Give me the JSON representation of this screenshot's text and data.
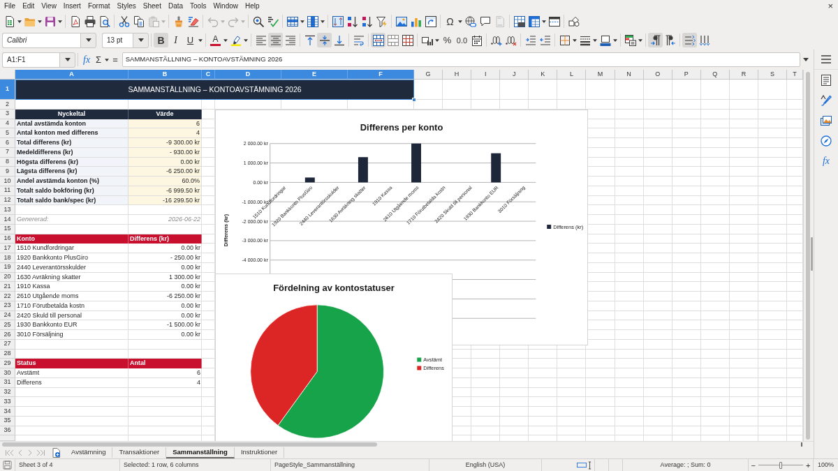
{
  "menu_bar": {
    "items": [
      "File",
      "Edit",
      "View",
      "Insert",
      "Format",
      "Styles",
      "Sheet",
      "Data",
      "Tools",
      "Window",
      "Help"
    ],
    "close": "×"
  },
  "standard_toolbar": {
    "special_character": "Ω",
    "disabled": {
      "paste": true,
      "undo": true,
      "redo": true,
      "headers_footers": true
    }
  },
  "formatting_toolbar": {
    "font_name": "Calibri",
    "font_size": "13 pt",
    "bold": "B",
    "italic": "I",
    "underline": "U",
    "font_color": "A",
    "percent": "%",
    "number": "0.0",
    "pressed": {
      "bold": true,
      "italic": false,
      "underline": false,
      "align_left": false,
      "align_center": true,
      "align_right": false,
      "align_top": false,
      "align_middle": true,
      "align_bottom": false,
      "wrap_text": false,
      "merge_and_center": true,
      "left_to_right": true,
      "right_to_left": false,
      "text_left_to_right": true,
      "text_top_to_bottom": false
    }
  },
  "formula_bar": {
    "name_box": "A1:F1",
    "function_wizard": "fx",
    "sum": "Σ",
    "equals": "=",
    "content": "SAMMANSTÄLLNING – KONTOAVSTÄMNING 2026"
  },
  "sheet": {
    "columns": [
      {
        "label": "A",
        "selected": true
      },
      {
        "label": "B",
        "selected": true
      },
      {
        "label": "C",
        "selected": true
      },
      {
        "label": "D",
        "selected": true
      },
      {
        "label": "E",
        "selected": true
      },
      {
        "label": "F",
        "selected": true
      },
      {
        "label": "G",
        "selected": false
      },
      {
        "label": "H",
        "selected": false
      },
      {
        "label": "I",
        "selected": false
      },
      {
        "label": "J",
        "selected": false
      },
      {
        "label": "K",
        "selected": false
      },
      {
        "label": "L",
        "selected": false
      },
      {
        "label": "M",
        "selected": false
      },
      {
        "label": "N",
        "selected": false
      },
      {
        "label": "O",
        "selected": false
      },
      {
        "label": "P",
        "selected": false
      },
      {
        "label": "Q",
        "selected": false
      },
      {
        "label": "R",
        "selected": false
      },
      {
        "label": "S",
        "selected": false
      },
      {
        "label": "T",
        "selected": false
      }
    ],
    "rows": [
      {
        "number": "1",
        "selected": true,
        "kind": "title",
        "cells": [
          "SAMMANSTÄLLNING – KONTOAVSTÄMNING 2026"
        ]
      },
      {
        "number": "2",
        "selected": false,
        "kind": "blank"
      },
      {
        "number": "3",
        "selected": false,
        "kind": "key_header",
        "cells": [
          "Nyckeltal",
          "Värde"
        ]
      },
      {
        "number": "4",
        "selected": false,
        "kind": "key_figure",
        "cells": [
          "Antal avstämda konton",
          "6"
        ]
      },
      {
        "number": "5",
        "selected": false,
        "kind": "key_figure",
        "cells": [
          "Antal konton med differens",
          "4"
        ]
      },
      {
        "number": "6",
        "selected": false,
        "kind": "key_figure",
        "cells": [
          "Total differens (kr)",
          "-9 300.00 kr"
        ]
      },
      {
        "number": "7",
        "selected": false,
        "kind": "key_figure",
        "cells": [
          "Medeldifferens (kr)",
          "- 930.00 kr"
        ]
      },
      {
        "number": "8",
        "selected": false,
        "kind": "key_figure",
        "cells": [
          "Högsta differens (kr)",
          "0.00 kr"
        ]
      },
      {
        "number": "9",
        "selected": false,
        "kind": "key_figure",
        "cells": [
          "Lägsta differens (kr)",
          "-6 250.00 kr"
        ]
      },
      {
        "number": "10",
        "selected": false,
        "kind": "key_figure",
        "cells": [
          "Andel avstämda konton (%)",
          "60.0%"
        ]
      },
      {
        "number": "11",
        "selected": false,
        "kind": "key_figure",
        "cells": [
          "Totalt saldo bokföring (kr)",
          "-6 999.50 kr"
        ]
      },
      {
        "number": "12",
        "selected": false,
        "kind": "key_figure",
        "cells": [
          "Totalt saldo bank/spec (kr)",
          "-16 299.50 kr"
        ]
      },
      {
        "number": "13",
        "selected": false,
        "kind": "blank"
      },
      {
        "number": "14",
        "selected": false,
        "kind": "note",
        "cells": [
          "Genererad:",
          "2026-06-22"
        ]
      },
      {
        "number": "15",
        "selected": false,
        "kind": "blank"
      },
      {
        "number": "16",
        "selected": false,
        "kind": "table_header",
        "cells": [
          "Konto",
          "Differens (kr)"
        ]
      },
      {
        "number": "17",
        "selected": false,
        "kind": "entry",
        "cells": [
          "1510 Kundfordringar",
          "0.00 kr"
        ]
      },
      {
        "number": "18",
        "selected": false,
        "kind": "entry",
        "cells": [
          "1920 Bankkonto PlusGiro",
          "- 250.00 kr"
        ]
      },
      {
        "number": "19",
        "selected": false,
        "kind": "entry",
        "cells": [
          "2440 Leverantörsskulder",
          "0.00 kr"
        ]
      },
      {
        "number": "20",
        "selected": false,
        "kind": "entry",
        "cells": [
          "1630 Avräkning skatter",
          "1 300.00 kr"
        ]
      },
      {
        "number": "21",
        "selected": false,
        "kind": "entry",
        "cells": [
          "1910 Kassa",
          "0.00 kr"
        ]
      },
      {
        "number": "22",
        "selected": false,
        "kind": "entry",
        "cells": [
          "2610 Utgående moms",
          "-6 250.00 kr"
        ]
      },
      {
        "number": "23",
        "selected": false,
        "kind": "entry",
        "cells": [
          "1710 Förutbetalda kostn",
          "0.00 kr"
        ]
      },
      {
        "number": "24",
        "selected": false,
        "kind": "entry",
        "cells": [
          "2420 Skuld till personal",
          "0.00 kr"
        ]
      },
      {
        "number": "25",
        "selected": false,
        "kind": "entry",
        "cells": [
          "1930 Bankkonto EUR",
          "-1 500.00 kr"
        ]
      },
      {
        "number": "26",
        "selected": false,
        "kind": "entry",
        "cells": [
          "3010 Försäljning",
          "0.00 kr"
        ]
      },
      {
        "number": "27",
        "selected": false,
        "kind": "blank"
      },
      {
        "number": "28",
        "selected": false,
        "kind": "blank"
      },
      {
        "number": "29",
        "selected": false,
        "kind": "table_header",
        "cells": [
          "Status",
          "Antal"
        ]
      },
      {
        "number": "30",
        "selected": false,
        "kind": "entry",
        "cells": [
          "Avstämt",
          "6"
        ]
      },
      {
        "number": "31",
        "selected": false,
        "kind": "entry",
        "cells": [
          "Differens",
          "4"
        ]
      },
      {
        "number": "32",
        "selected": false,
        "kind": "blank"
      },
      {
        "number": "33",
        "selected": false,
        "kind": "blank"
      },
      {
        "number": "34",
        "selected": false,
        "kind": "blank"
      },
      {
        "number": "35",
        "selected": false,
        "kind": "blank"
      },
      {
        "number": "36",
        "selected": false,
        "kind": "blank"
      }
    ]
  },
  "bar_chart": {
    "chart_data": {
      "type": "bar",
      "title": "Differens per konto",
      "ylabel": "Differens (kr)",
      "categories": [
        "1510 Kundfordringar",
        "1920 Bankkonto PlusGiro",
        "2440 Leverantörsskulder",
        "1630 Avräkning skatter",
        "1910 Kassa",
        "2610 Utgående moms",
        "1710 Förutbetalda kostn",
        "2420 Skuld till personal",
        "1930 Bankkonto EUR",
        "3010 Försäljning"
      ],
      "series": [
        {
          "name": "Differens (kr)",
          "color": "#1e2639",
          "values": [
            0,
            250,
            0,
            1300,
            0,
            2000,
            0,
            0,
            1500,
            0
          ]
        }
      ],
      "ylim": [
        -7000,
        2000
      ],
      "yticks": [
        {
          "value": 2000,
          "label": "2 000.00 kr"
        },
        {
          "value": 1000,
          "label": "1 000.00 kr"
        },
        {
          "value": 0,
          "label": "0.00 kr"
        },
        {
          "value": -1000,
          "label": "-1 000.00 kr"
        },
        {
          "value": -2000,
          "label": "-2 000.00 kr"
        },
        {
          "value": -3000,
          "label": "-3 000.00 kr"
        },
        {
          "value": -4000,
          "label": "-4 000.00 kr"
        }
      ],
      "grid": true,
      "legend": "right"
    }
  },
  "pie_chart": {
    "chart_data": {
      "type": "pie",
      "title": "Fördelning av kontostatuser",
      "categories": [
        "Avstämt",
        "Differens"
      ],
      "values": [
        60,
        40
      ],
      "colors": [
        "#17a34a",
        "#dc2626"
      ],
      "legend": "right"
    }
  },
  "sidebar": {
    "functions": "fx"
  },
  "sheet_tabs": [
    {
      "label": "Avstämning",
      "selected": false
    },
    {
      "label": "Transaktioner",
      "selected": false
    },
    {
      "label": "Sammanställning",
      "selected": true
    },
    {
      "label": "Instruktioner",
      "selected": false
    }
  ],
  "status_bar": {
    "sheet": "Sheet 3 of 4",
    "selection": "Selected: 1 row, 6 columns",
    "page_style": "PageStyle_Sammanställning",
    "language": "English (USA)",
    "summary": "Average: ; Sum: 0",
    "zoom_out": "−",
    "zoom": {
      "level": 0.5
    },
    "zoom_in": "+",
    "zoom_reading": "100%"
  }
}
